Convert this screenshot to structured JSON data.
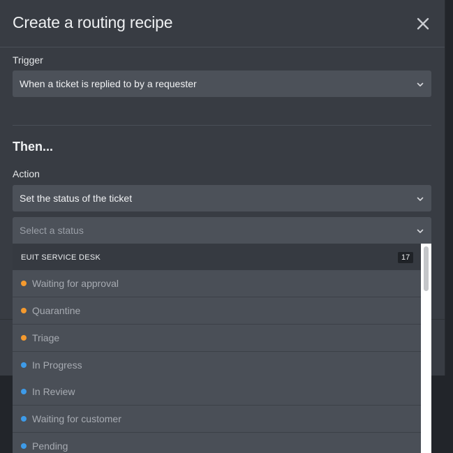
{
  "modal": {
    "title": "Create a routing recipe",
    "close_icon": "close-icon"
  },
  "trigger": {
    "label": "Trigger",
    "value": "When a ticket is replied to by a requester"
  },
  "then_section": {
    "title": "Then..."
  },
  "action": {
    "label": "Action",
    "value": "Set the status of the ticket"
  },
  "status_select": {
    "placeholder": "Select a status"
  },
  "dropdown": {
    "group_name": "EUIT SERVICE DESK",
    "group_count": "17",
    "options": [
      {
        "label": "Waiting for approval",
        "color": "#f59a2e"
      },
      {
        "label": "Quarantine",
        "color": "#f59a2e"
      },
      {
        "label": "Triage",
        "color": "#f59a2e"
      },
      {
        "label": "In Progress",
        "color": "#3d9be9"
      },
      {
        "label": "In Review",
        "color": "#3d9be9"
      },
      {
        "label": "Waiting for customer",
        "color": "#3d9be9"
      },
      {
        "label": "Pending",
        "color": "#3d9be9"
      }
    ]
  },
  "colors": {
    "modal_bg": "#383c43",
    "select_bg": "#4c5159",
    "status_orange": "#f59a2e",
    "status_blue": "#3d9be9"
  }
}
